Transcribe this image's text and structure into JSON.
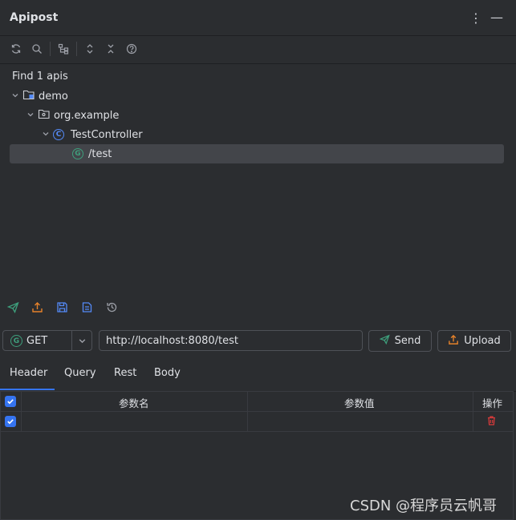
{
  "panel": {
    "title": "Apipost"
  },
  "tree": {
    "summary": "Find 1 apis",
    "root": "demo",
    "package": "org.example",
    "controller": "TestController",
    "controller_badge": "C",
    "endpoint": "/test",
    "endpoint_badge": "G"
  },
  "request": {
    "method": "GET",
    "method_badge": "G",
    "url": "http://localhost:8080/test",
    "send_label": "Send",
    "upload_label": "Upload"
  },
  "tabs": [
    "Header",
    "Query",
    "Rest",
    "Body"
  ],
  "active_tab": "Header",
  "params_table": {
    "columns": [
      "参数名",
      "参数值",
      "操作"
    ],
    "rows": [
      {
        "checked": true,
        "name": "",
        "value": ""
      }
    ]
  },
  "watermark": "CSDN @程序员云帆哥",
  "colors": {
    "accent": "#3574f0",
    "get_green": "#3e9f7c",
    "class_blue": "#548af7",
    "upload_orange": "#e6822a",
    "delete_red": "#db3b3b"
  }
}
